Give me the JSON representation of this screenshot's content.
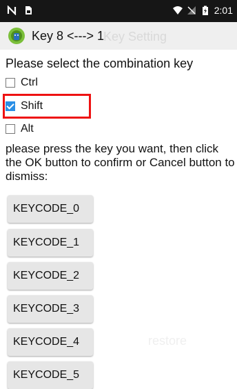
{
  "status_bar": {
    "time": "2:01",
    "icons": [
      "notification-n-icon",
      "sim-card-icon",
      "wifi-icon",
      "no-signal-icon",
      "battery-icon"
    ]
  },
  "action_bar": {
    "title": "Key 8 <---> 1",
    "ghost_title": "Key Setting",
    "app_icon": "android-icon"
  },
  "form": {
    "prompt": "Please select the combination key",
    "checkboxes": [
      {
        "label": "Ctrl",
        "checked": false
      },
      {
        "label": "Shift",
        "checked": true
      },
      {
        "label": "Alt",
        "checked": false
      }
    ],
    "highlight_color": "#ee1111",
    "instructions": "please press the key you want, then click the OK button to confirm or Cancel button to dismiss:"
  },
  "keycodes": [
    "KEYCODE_0",
    "KEYCODE_1",
    "KEYCODE_2",
    "KEYCODE_3",
    "KEYCODE_4",
    "KEYCODE_5"
  ],
  "background_ghost": {
    "restore": "restore"
  }
}
